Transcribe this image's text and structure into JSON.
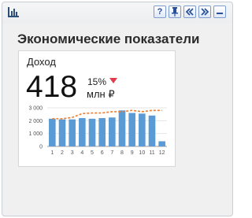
{
  "toolbar": {
    "help_label": "?",
    "icons": [
      "bar-chart-icon",
      "help-icon",
      "pin-icon",
      "collapse-left-icon",
      "expand-right-icon",
      "minimize-icon"
    ]
  },
  "panel": {
    "title": "Экономические показатели"
  },
  "kpi": {
    "title": "Доход",
    "value": "418",
    "change": "15%",
    "change_direction": "down",
    "unit": "млн ₽",
    "colors": {
      "bars": "#5b9bd5",
      "trend": "#ed7d31",
      "arrow": "#e23b4e"
    }
  },
  "chart_data": {
    "type": "bar",
    "categories": [
      "1",
      "2",
      "3",
      "4",
      "5",
      "6",
      "7",
      "8",
      "9",
      "10",
      "11",
      "12"
    ],
    "series": [
      {
        "type": "bar",
        "values": [
          2150,
          2100,
          2100,
          2200,
          2150,
          2200,
          2250,
          2800,
          2600,
          2550,
          2400,
          400
        ]
      },
      {
        "type": "line",
        "style": "dashed",
        "values": [
          2150,
          2150,
          2250,
          2550,
          2600,
          2600,
          2700,
          2700,
          2800,
          2700,
          2800,
          2800
        ]
      }
    ],
    "y_ticks": [
      "0",
      "1 000",
      "2 000",
      "3 000"
    ],
    "ylim": [
      0,
      3000
    ],
    "grid": true
  }
}
